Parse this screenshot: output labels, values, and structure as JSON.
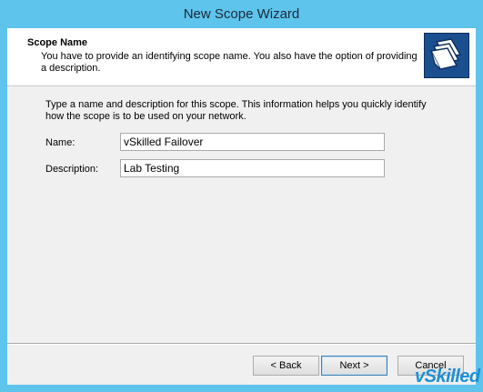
{
  "window": {
    "title": "New Scope Wizard"
  },
  "header": {
    "title": "Scope Name",
    "description": "You have to provide an identifying scope name. You also have the option of providing a description.",
    "icon": "folders-icon"
  },
  "body": {
    "instructions": "Type a name and description for this scope. This information helps you quickly identify how the scope is to be used on your network.",
    "name_label": "Name:",
    "name_value": "vSkilled Failover",
    "description_label": "Description:",
    "description_value": "Lab Testing"
  },
  "buttons": {
    "back": "< Back",
    "next": "Next >",
    "cancel": "Cancel"
  },
  "watermark": {
    "text": "vSkilled"
  }
}
